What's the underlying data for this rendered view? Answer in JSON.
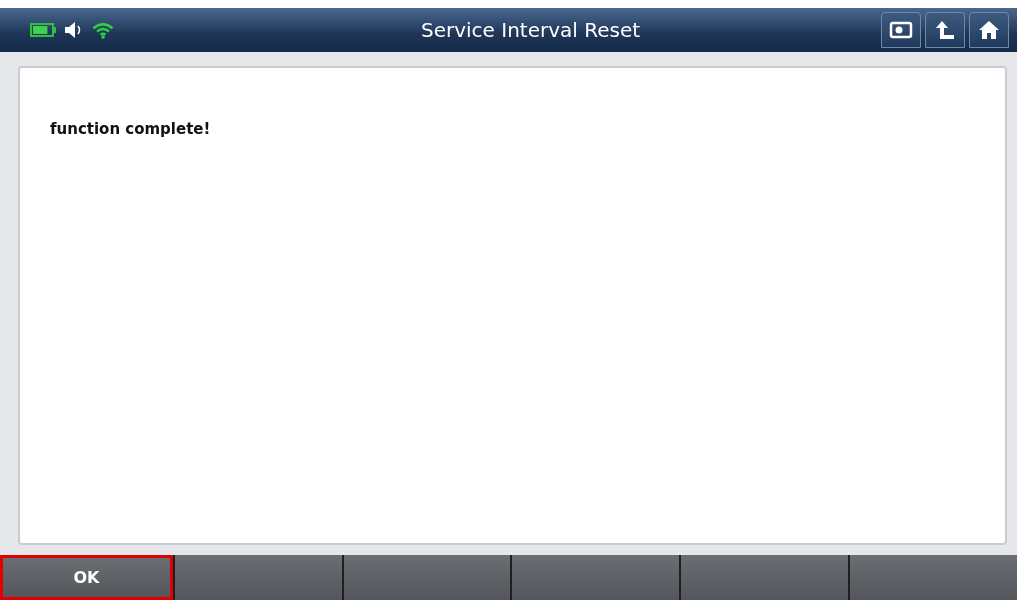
{
  "window": {
    "title": "Service Interval Reset"
  },
  "message": "function complete!",
  "function_keys": [
    {
      "label": "OK",
      "selected": true
    },
    {
      "selected": false
    },
    {
      "selected": false
    },
    {
      "selected": false
    },
    {
      "selected": false
    },
    {
      "selected": false
    }
  ]
}
